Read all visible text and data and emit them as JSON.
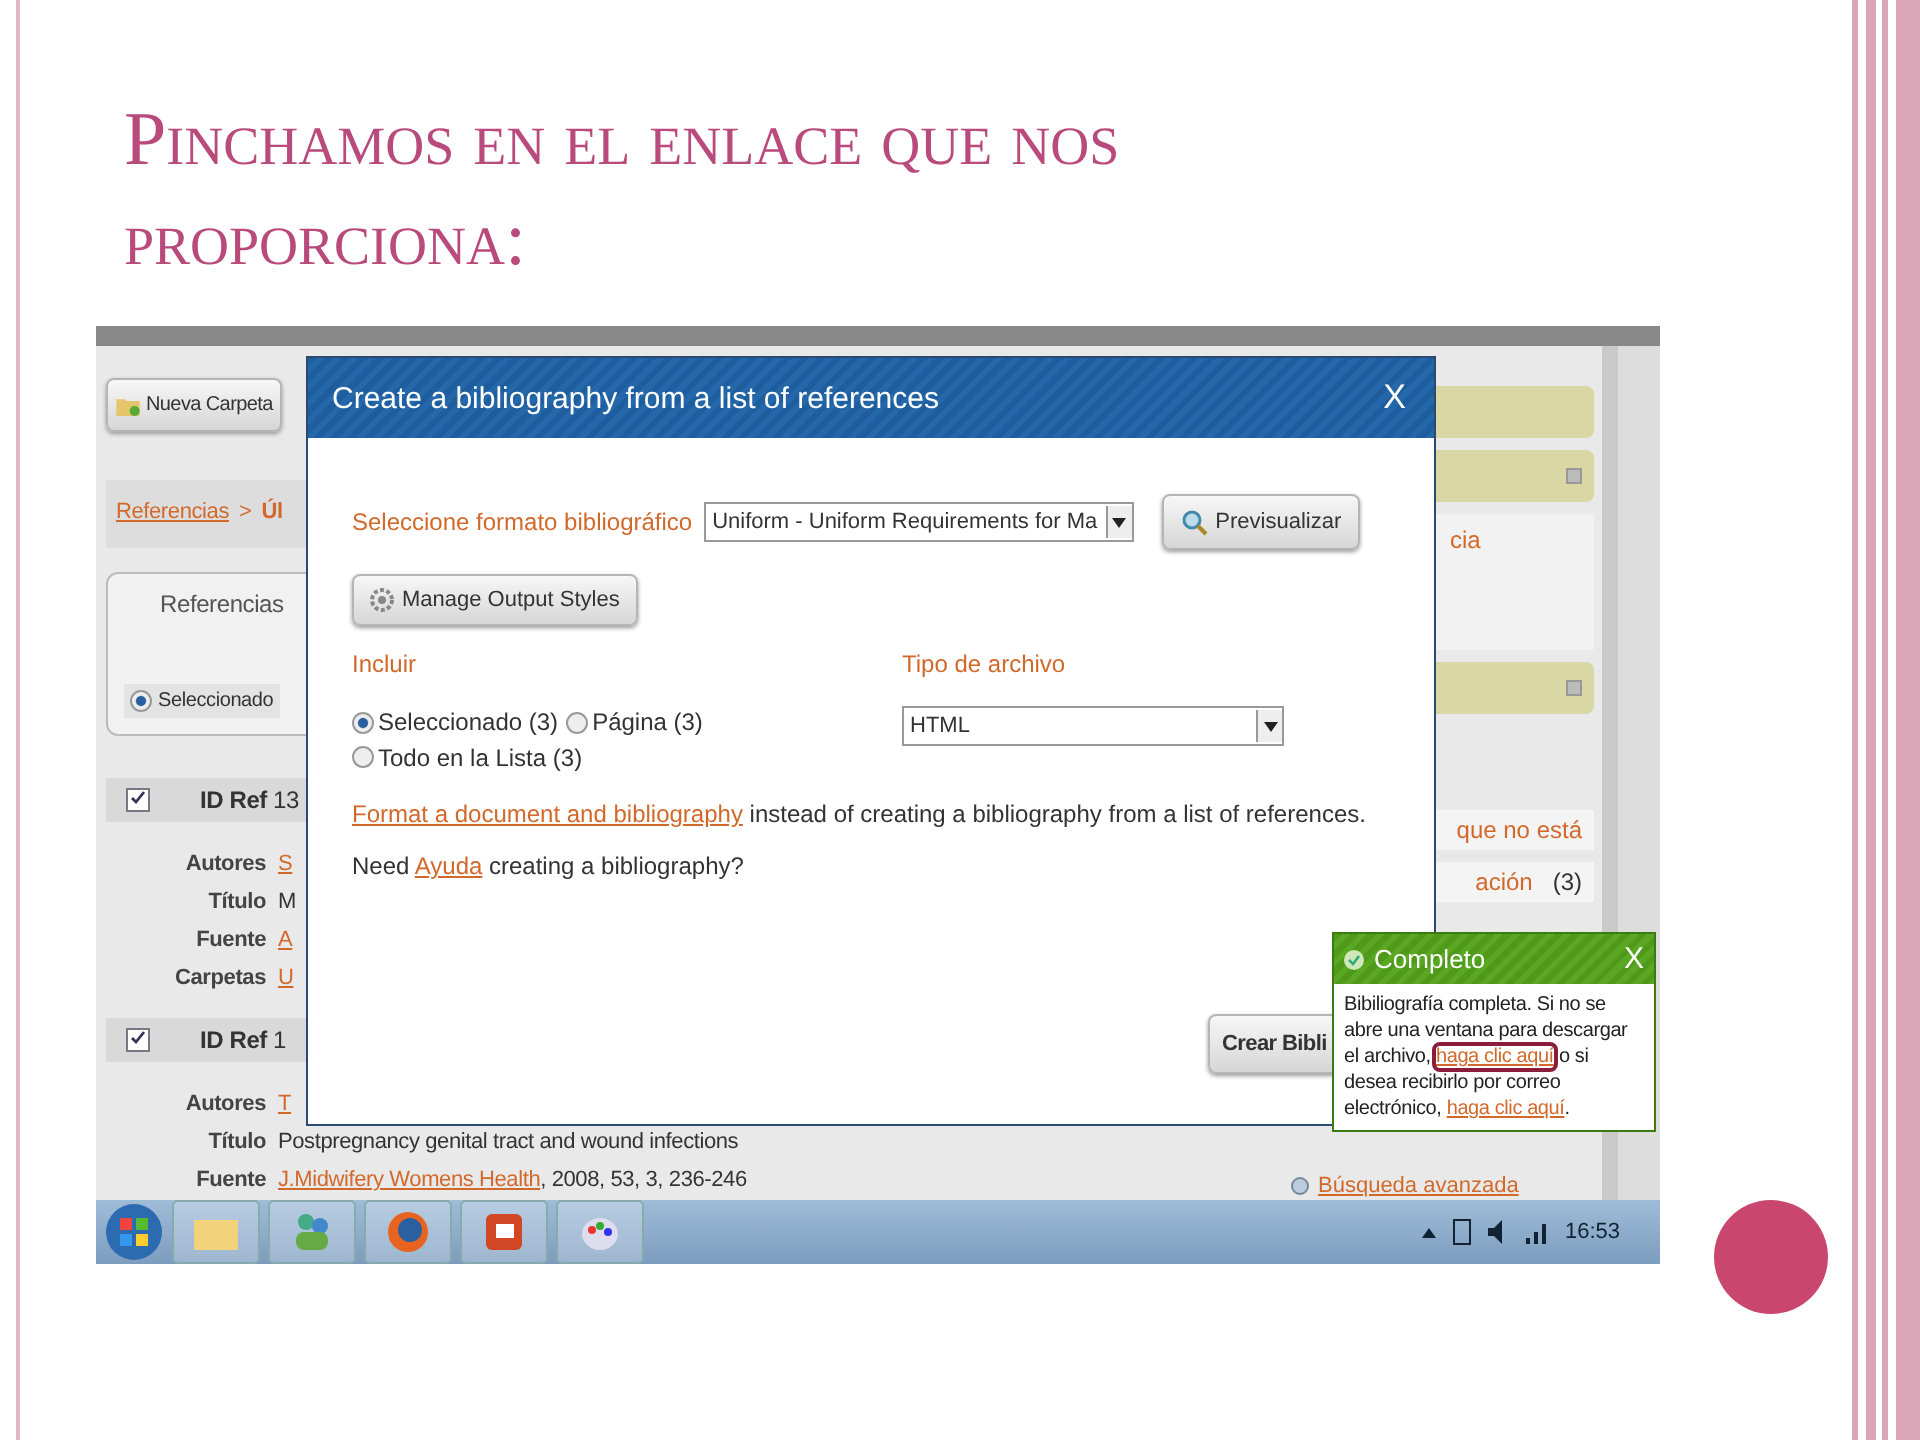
{
  "slide": {
    "title": "Pinchamos en el enlace que nos proporciona:"
  },
  "app": {
    "toolbar_button": "Nueva Carpeta",
    "breadcrumb": {
      "root": "Referencias",
      "separator": ">",
      "current": "Úl"
    },
    "panel": {
      "title": "Referencias",
      "option": {
        "label": "Seleccionado",
        "selected": true
      }
    },
    "records": [
      {
        "checked": true,
        "id_label": "ID Ref",
        "id": "13",
        "fields": [
          {
            "label": "Autores",
            "value": "S",
            "kind": "link"
          },
          {
            "label": "Título",
            "value": "M",
            "kind": "text"
          },
          {
            "label": "Fuente",
            "value": "A",
            "kind": "link"
          },
          {
            "label": "Carpetas",
            "value": "U",
            "kind": "link"
          }
        ]
      },
      {
        "checked": true,
        "id_label": "ID Ref",
        "id": "1",
        "fields": [
          {
            "label": "Autores",
            "value": "T",
            "kind": "link"
          },
          {
            "label": "Título",
            "value": "Postpregnancy genital tract and wound infections",
            "kind": "text"
          },
          {
            "label": "Fuente",
            "value": "J.Midwifery Womens Health",
            "rest": ", 2008, 53, 3, 236-246",
            "kind": "link"
          }
        ]
      }
    ],
    "sidebar": {
      "first_panel_text": "cia",
      "list_items": [
        {
          "text": "que no está"
        },
        {
          "text": "ación",
          "count": "(3)"
        }
      ],
      "search_link": "Búsqueda avanzada"
    },
    "hidden_button": "Crear Bibli"
  },
  "dialog": {
    "title": "Create a bibliography from a list of references",
    "close": "X",
    "format_label": "Seleccione formato bibliográfico",
    "format_value": "Uniform - Uniform Requirements for Ma",
    "preview_button": "Previsualizar",
    "styles_button": "Manage Output Styles",
    "include_label": "Incluir",
    "include_options": [
      {
        "label": "Seleccionado (3)",
        "selected": true
      },
      {
        "label": "Página (3)",
        "selected": false
      },
      {
        "label": "Todo en la Lista (3)",
        "selected": false
      }
    ],
    "filetype_label": "Tipo de archivo",
    "filetype_value": "HTML",
    "format_link": "Format a document and bibliography",
    "format_rest": " instead of creating a bibliography from a list of references.",
    "help_before": "Need ",
    "help_link": "Ayuda",
    "help_after": " creating a bibliography?"
  },
  "notification": {
    "title": "Completo",
    "close": "X",
    "parts": [
      {
        "kind": "text",
        "text": "Bibiliografía completa. Si no se abre una ventana para descargar el archivo, "
      },
      {
        "kind": "link",
        "text": "haga clic aquí",
        "highlighted": true
      },
      {
        "kind": "text",
        "text": " o si desea recibirlo por correo electrónico, "
      },
      {
        "kind": "link",
        "text": "haga clic aquí",
        "highlighted": false
      },
      {
        "kind": "text",
        "text": "."
      }
    ]
  },
  "taskbar": {
    "clock": "16:53"
  }
}
